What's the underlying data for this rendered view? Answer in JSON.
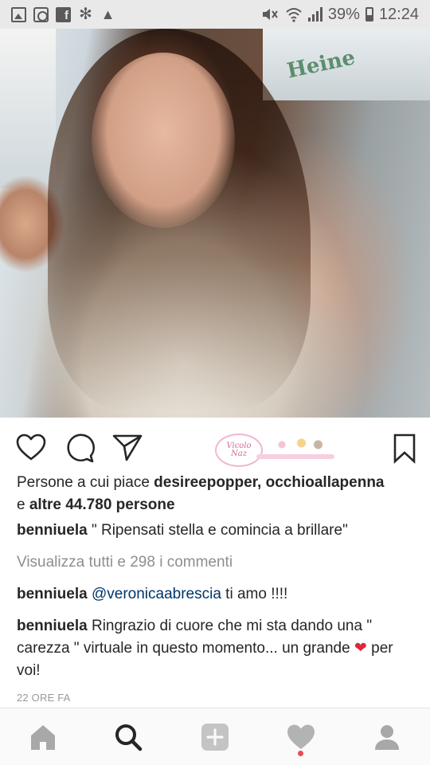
{
  "status_bar": {
    "battery_percent": "39%",
    "time": "12:24",
    "notification_icons": [
      "gallery-icon",
      "settings-icon",
      "facebook-icon",
      "flower-icon",
      "warning-icon"
    ],
    "system_icons": [
      "mute-icon",
      "wifi-icon",
      "signal-icon",
      "battery-icon"
    ]
  },
  "post": {
    "likes": {
      "prefix": "Persone a cui piace ",
      "users": "desireepopper, occhioallapenna",
      "conjunction": "e ",
      "others": "altre 44.780 persone"
    },
    "caption": {
      "username": "benniuela",
      "text": " \" Ripensati stella e comincia a brillare\""
    },
    "view_all_comments": "Visualizza tutti e 298 i commenti",
    "comments": [
      {
        "username": "benniuela",
        "mention": "@veronicaabrescia",
        "text": " ti amo !!!!"
      },
      {
        "username": "benniuela",
        "text": " Ringrazio di cuore che mi sta dando una \" carezza \" virtuale in questo momento... un grande ",
        "text_after": " per voi!"
      }
    ],
    "timestamp": "22 ORE FA",
    "actions": [
      "heart-outline-icon",
      "comment-bubble-icon",
      "send-arrow-icon",
      "bookmark-icon"
    ]
  },
  "bottom_nav": {
    "items": [
      "home-icon",
      "search-icon",
      "add-post-icon",
      "activity-heart-icon",
      "profile-icon"
    ],
    "active_item": "search-icon",
    "notification_dot_color": "#ed4956"
  },
  "colors": {
    "text_primary": "#262626",
    "text_secondary": "#8e8e8e",
    "mention": "#003569",
    "status_bar_bg": "#e9e9e9",
    "nav_bg": "#fafafa"
  }
}
